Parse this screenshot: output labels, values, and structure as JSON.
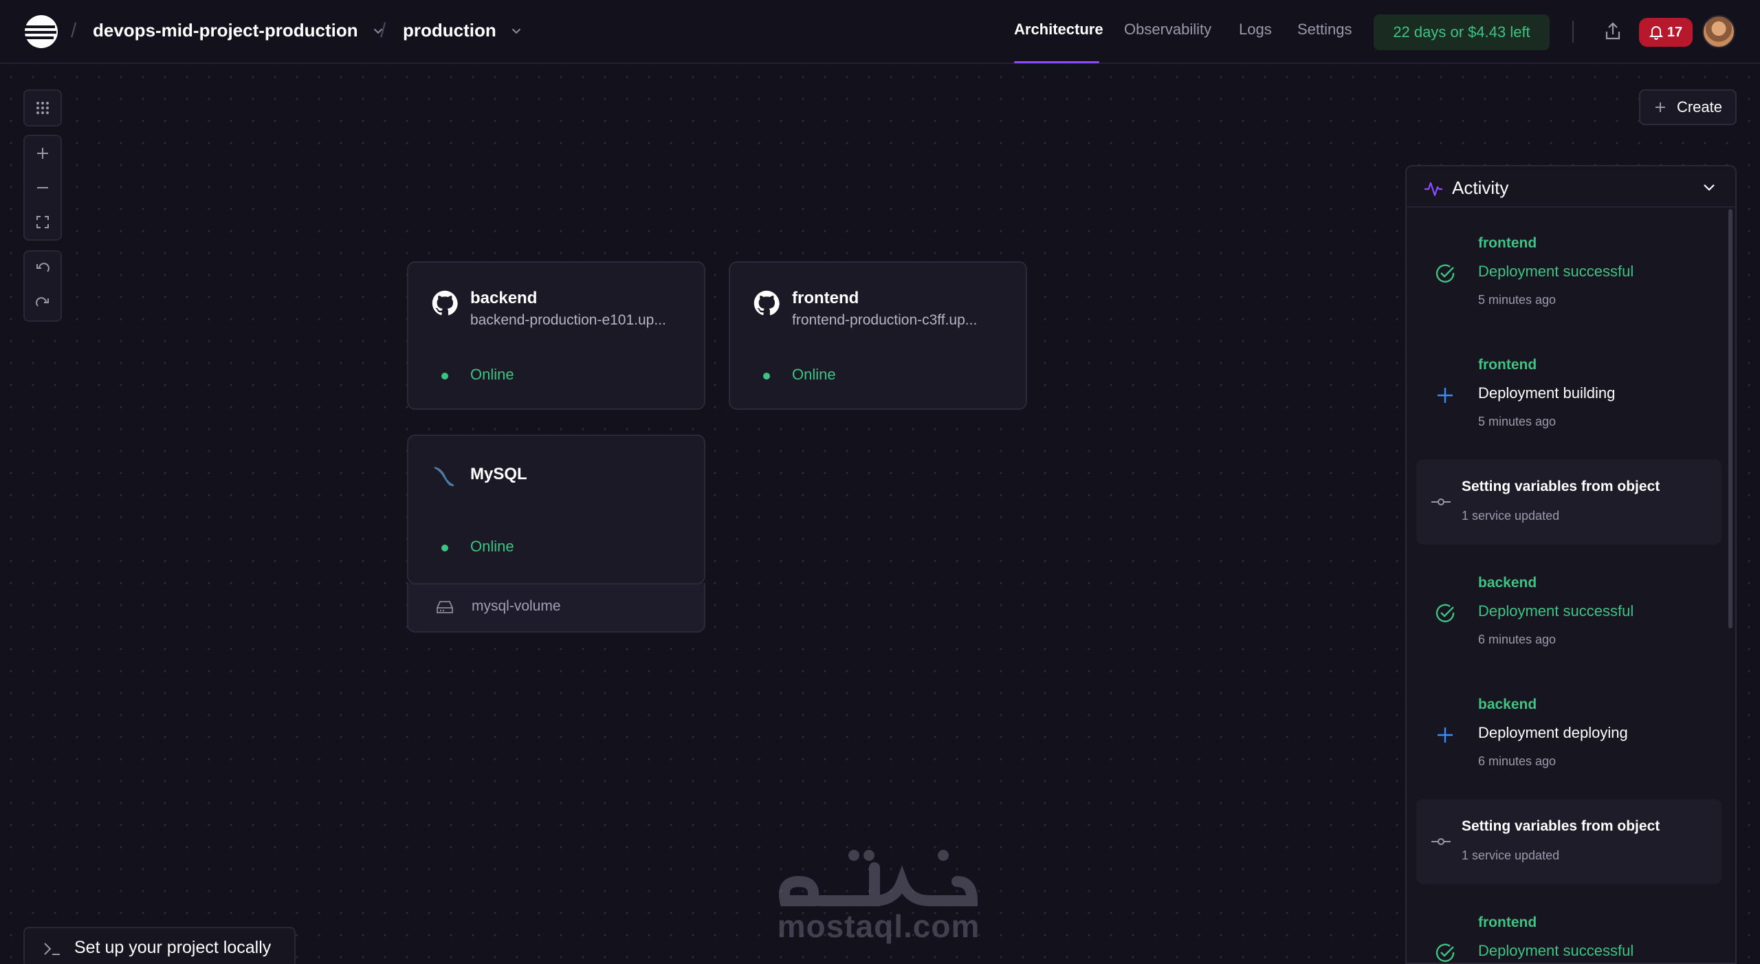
{
  "header": {
    "project": "devops-mid-project-production",
    "environment": "production",
    "tabs": [
      {
        "label": "Architecture",
        "active": true
      },
      {
        "label": "Observability",
        "active": false
      },
      {
        "label": "Logs",
        "active": false
      },
      {
        "label": "Settings",
        "active": false
      }
    ],
    "trial": "22 days or $4.43 left",
    "notification_count": "17"
  },
  "toolbar": {
    "create_label": "Create"
  },
  "services": [
    {
      "name": "backend",
      "url": "backend-production-e101.up...",
      "status": "Online",
      "icon": "github-icon"
    },
    {
      "name": "frontend",
      "url": "frontend-production-c3ff.up...",
      "status": "Online",
      "icon": "github-icon"
    },
    {
      "name": "MySQL",
      "url": "",
      "status": "Online",
      "icon": "mysql-dolphin-icon",
      "volume": "mysql-volume"
    }
  ],
  "activity": {
    "title": "Activity",
    "items": [
      {
        "service": "frontend",
        "event": "Deployment successful",
        "time": "5 minutes ago",
        "kind": "success"
      },
      {
        "service": "frontend",
        "event": "Deployment building",
        "time": "5 minutes ago",
        "kind": "progress"
      },
      {
        "title": "Setting variables from object",
        "subtitle": "1 service updated",
        "kind": "variables"
      },
      {
        "service": "backend",
        "event": "Deployment successful",
        "time": "6 minutes ago",
        "kind": "success"
      },
      {
        "service": "backend",
        "event": "Deployment deploying",
        "time": "6 minutes ago",
        "kind": "progress"
      },
      {
        "title": "Setting variables from object",
        "subtitle": "1 service updated",
        "kind": "variables"
      },
      {
        "service": "frontend",
        "event": "Deployment successful",
        "time": "",
        "kind": "success"
      }
    ]
  },
  "footer": {
    "setup_label": "Set up your project locally"
  },
  "watermark": {
    "arabic": "مستقل",
    "latin": "mostaql.com"
  },
  "colors": {
    "accent": "#8b4dff",
    "success": "#3fc382",
    "danger": "#b8182c",
    "info": "#3b8cff"
  }
}
